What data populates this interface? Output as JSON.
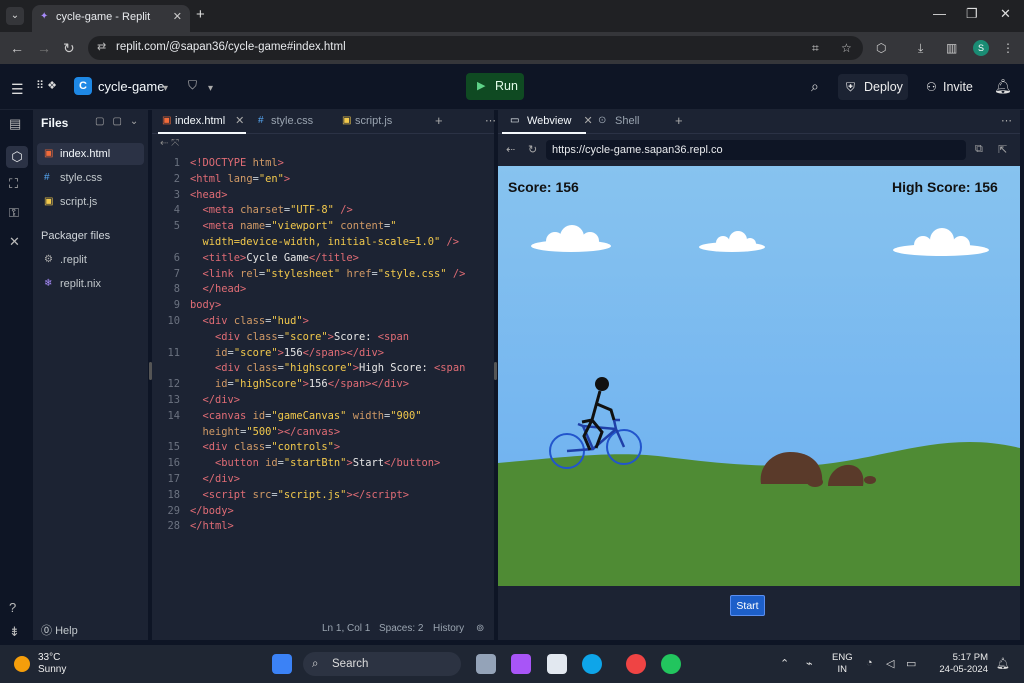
{
  "browser": {
    "tab_title": "cycle-game - Replit",
    "url": "replit.com/@sapan36/cycle-game#index.html",
    "profile_initial": "S"
  },
  "header": {
    "project": "cycle-game",
    "run_label": "Run",
    "deploy_label": "Deploy",
    "invite_label": "Invite"
  },
  "files": {
    "title": "Files",
    "items": [
      "index.html",
      "style.css",
      "script.js"
    ],
    "packager_title": "Packager files",
    "packager_items": [
      ".replit",
      "replit.nix"
    ],
    "help": "Help"
  },
  "editor": {
    "tabs": [
      "index.html",
      "style.css",
      "script.js"
    ],
    "line_numbers": [
      "1",
      "2",
      "3",
      "4",
      "5",
      "",
      "6",
      "7",
      "8",
      "9",
      "10",
      "",
      "11",
      "",
      "12",
      "13",
      "14",
      "",
      "15",
      "16",
      "17",
      "18",
      "29",
      "28"
    ],
    "status": {
      "position": "Ln 1, Col 1",
      "spaces": "Spaces: 2",
      "history": "History"
    }
  },
  "webview": {
    "tabs": [
      "Webview",
      "Shell"
    ],
    "url": "https://cycle-game.sapan36.repl.co",
    "score": "Score: 156",
    "high_score": "High Score: 156",
    "start_label": "Start"
  },
  "taskbar": {
    "temp": "33°C",
    "weather": "Sunny",
    "search": "Search",
    "lang1": "ENG",
    "lang2": "IN",
    "time": "5:17 PM",
    "date": "24-05-2024"
  }
}
